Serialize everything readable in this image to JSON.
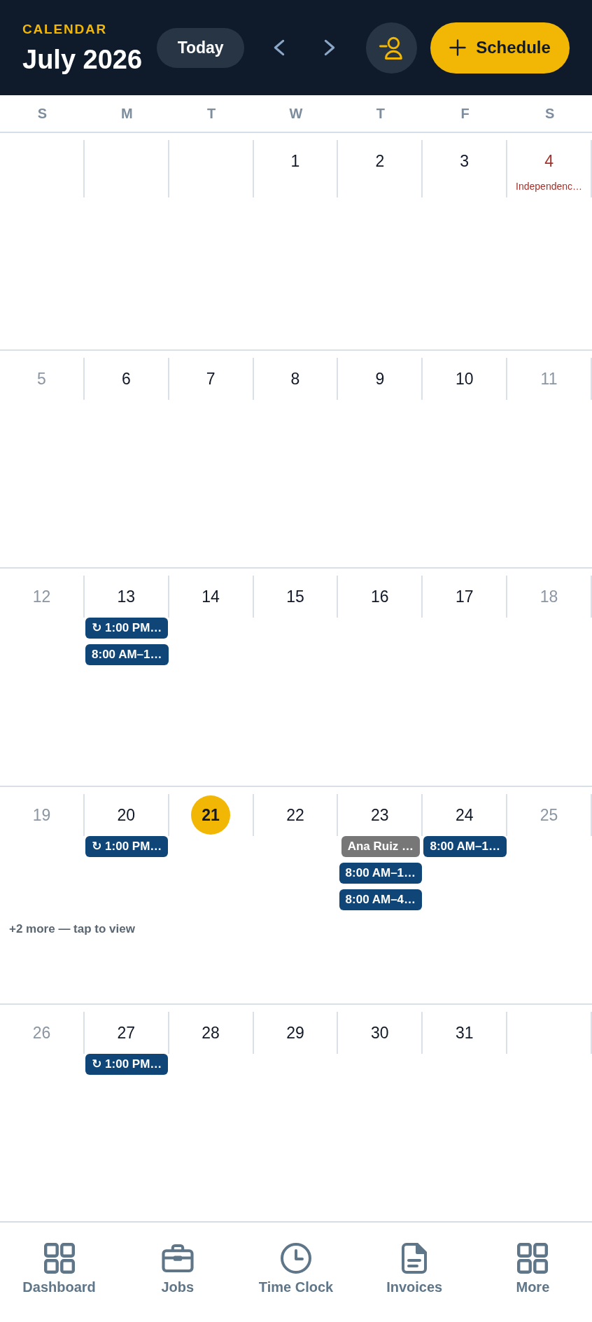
{
  "header": {
    "label": "CALENDAR",
    "title": "July 2026",
    "today_button": "Today",
    "schedule_button": "Schedule"
  },
  "weekdays": [
    "S",
    "M",
    "T",
    "W",
    "T",
    "F",
    "S"
  ],
  "weeks": [
    {
      "days": [
        {
          "kind": "blank"
        },
        {
          "kind": "blank"
        },
        {
          "kind": "blank"
        },
        {
          "kind": "date",
          "date": "1",
          "today": false
        },
        {
          "kind": "date",
          "date": "2",
          "today": false
        },
        {
          "kind": "date",
          "date": "3",
          "today": false
        },
        {
          "kind": "date",
          "date": "4",
          "today": false,
          "holiday": "Independenc…"
        }
      ]
    },
    {
      "days": [
        {
          "kind": "date",
          "date": "5",
          "today": false
        },
        {
          "kind": "date",
          "date": "6",
          "today": false
        },
        {
          "kind": "date",
          "date": "7",
          "today": false
        },
        {
          "kind": "date",
          "date": "8",
          "today": false
        },
        {
          "kind": "date",
          "date": "9",
          "today": false
        },
        {
          "kind": "date",
          "date": "10",
          "today": false
        },
        {
          "kind": "date",
          "date": "11",
          "today": false
        }
      ]
    },
    {
      "days": [
        {
          "kind": "date",
          "date": "12",
          "today": false
        },
        {
          "kind": "date",
          "date": "13",
          "today": false,
          "events": [
            {
              "text": "↻ 1:00 PM…",
              "color": "#0f4577"
            },
            {
              "text": "8:00 AM–1…",
              "color": "#0f4577"
            }
          ]
        },
        {
          "kind": "date",
          "date": "14",
          "today": false
        },
        {
          "kind": "date",
          "date": "15",
          "today": false
        },
        {
          "kind": "date",
          "date": "16",
          "today": false
        },
        {
          "kind": "date",
          "date": "17",
          "today": false
        },
        {
          "kind": "date",
          "date": "18",
          "today": false
        }
      ]
    },
    {
      "days": [
        {
          "kind": "date",
          "date": "19",
          "today": false
        },
        {
          "kind": "date",
          "date": "20",
          "today": false,
          "events": [
            {
              "text": "↻ 1:00 PM…",
              "color": "#0f4577"
            }
          ]
        },
        {
          "kind": "date",
          "date": "21",
          "today": true
        },
        {
          "kind": "date",
          "date": "22",
          "today": false
        },
        {
          "kind": "date",
          "date": "23",
          "today": false,
          "events": [
            {
              "text": "Ana Ruiz …",
              "color": "#777777"
            },
            {
              "text": "8:00 AM–1…",
              "color": "#0f4577"
            },
            {
              "text": "8:00 AM–4…",
              "color": "#0f4577"
            }
          ]
        },
        {
          "kind": "date",
          "date": "24",
          "today": false,
          "events": [
            {
              "text": "8:00 AM–1…",
              "color": "#0f4577"
            }
          ]
        },
        {
          "kind": "date",
          "date": "25",
          "today": false
        }
      ],
      "more": "+2 more — tap to view"
    },
    {
      "days": [
        {
          "kind": "date",
          "date": "26",
          "today": false
        },
        {
          "kind": "date",
          "date": "27",
          "today": false,
          "events": [
            {
              "text": "↻ 1:00 PM…",
              "color": "#0f4577"
            }
          ]
        },
        {
          "kind": "date",
          "date": "28",
          "today": false
        },
        {
          "kind": "date",
          "date": "29",
          "today": false
        },
        {
          "kind": "date",
          "date": "30",
          "today": false
        },
        {
          "kind": "date",
          "date": "31",
          "today": false
        },
        {
          "kind": "blank"
        }
      ]
    }
  ],
  "nav": [
    {
      "label": "Dashboard",
      "selected": false
    },
    {
      "label": "Jobs",
      "selected": false
    },
    {
      "label": "Time Clock",
      "selected": false
    },
    {
      "label": "Invoices",
      "selected": false
    },
    {
      "label": "More",
      "selected": false
    }
  ]
}
